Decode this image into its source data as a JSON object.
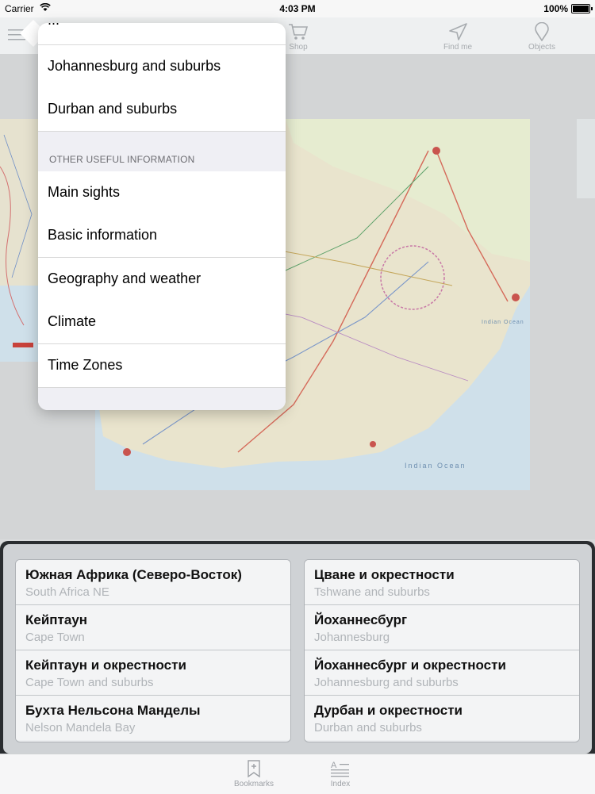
{
  "status_bar": {
    "carrier": "Carrier",
    "time": "4:03 PM",
    "battery": "100%"
  },
  "nav": {
    "shop": "Shop",
    "find_me": "Find me",
    "objects": "Objects"
  },
  "popover": {
    "partial_item": "...",
    "items_top": [
      "Johannesburg and suburbs",
      "Durban and suburbs"
    ],
    "section_header": "OTHER USEFUL INFORMATION",
    "items_info": [
      "Main sights",
      "Basic information",
      "Geography and weather",
      "Climate",
      "Time Zones"
    ]
  },
  "map_labels": {
    "ocean1": "Indian Ocean",
    "ocean2": "Indian Ocean"
  },
  "maps_left": [
    {
      "ru": "Южная Африка (Северо-Восток)",
      "en": "South Africa NE"
    },
    {
      "ru": "Кейптаун",
      "en": "Cape Town"
    },
    {
      "ru": "Кейптаун и окрестности",
      "en": "Cape Town and suburbs"
    },
    {
      "ru": "Бухта Нельсона Манделы",
      "en": "Nelson Mandela Bay"
    }
  ],
  "maps_right": [
    {
      "ru": "Цване и окрестности",
      "en": "Tshwane and suburbs"
    },
    {
      "ru": "Йоханнесбург",
      "en": "Johannesburg"
    },
    {
      "ru": "Йоханнесбург и окрестности",
      "en": "Johannesburg and suburbs"
    },
    {
      "ru": "Дурбан и окрестности",
      "en": "Durban and suburbs"
    }
  ],
  "tabs": {
    "bookmarks": "Bookmarks",
    "index": "Index"
  }
}
